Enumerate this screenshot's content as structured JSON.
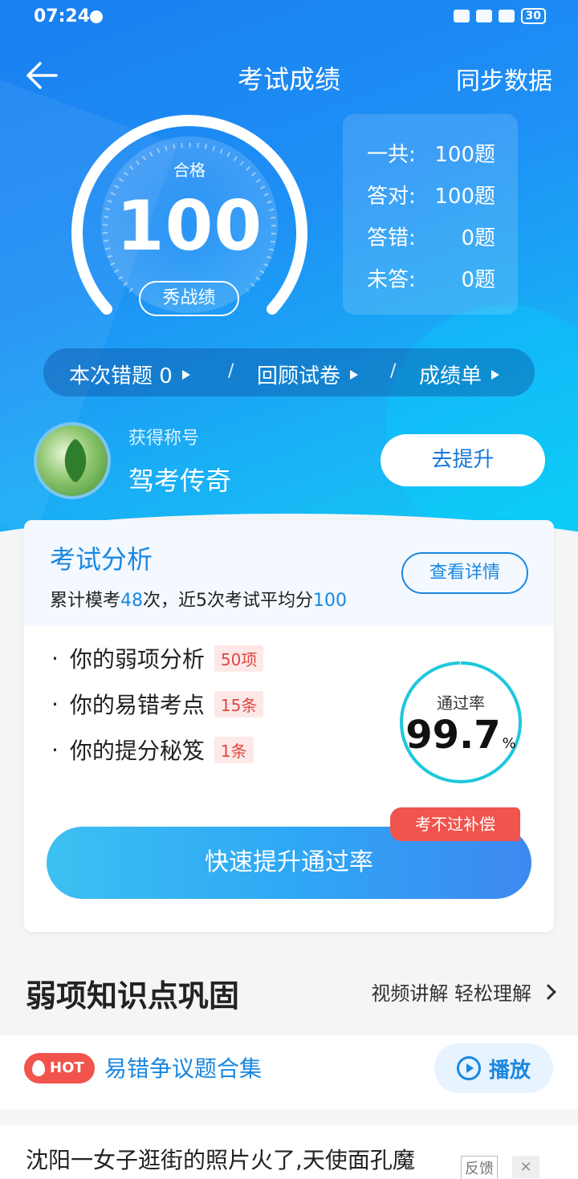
{
  "status": {
    "time": "07:24",
    "battery": "30"
  },
  "nav": {
    "title": "考试成绩",
    "sync": "同步数据"
  },
  "score": {
    "label": "合格",
    "value": "100",
    "show_btn": "秀战绩"
  },
  "stats": [
    {
      "k": "一共:",
      "v": "100题"
    },
    {
      "k": "答对:",
      "v": "100题"
    },
    {
      "k": "答错:",
      "v": "0题"
    },
    {
      "k": "未答:",
      "v": "0题"
    }
  ],
  "pills": {
    "wrong": "本次错题 0",
    "review": "回顾试卷",
    "report": "成绩单",
    "sep": "/"
  },
  "honor": {
    "label": "获得称号",
    "value": "驾考传奇",
    "btn": "去提升"
  },
  "analysis": {
    "title": "考试分析",
    "sub_prefix": "累计模考",
    "count": "48",
    "sub_mid": "次，近5次考试平均分",
    "avg": "100",
    "detail_btn": "查看详情",
    "items": [
      {
        "dot": "·",
        "label": "你的弱项分析",
        "tag": "50项"
      },
      {
        "dot": "·",
        "label": "你的易错考点",
        "tag": "15条"
      },
      {
        "dot": "·",
        "label": "你的提分秘笈",
        "tag": "1条"
      }
    ],
    "rate_label": "通过率",
    "rate_value": "99.7",
    "rate_unit": "%",
    "rate_fraction": 0.997,
    "boost_btn": "快速提升通过率",
    "compensate": "考不过补偿"
  },
  "weak": {
    "title": "弱项知识点巩固",
    "link": "视频讲解 轻松理解"
  },
  "hot": {
    "badge": "HOT",
    "text": "易错争议题合集",
    "play": "播放"
  },
  "news": {
    "text": "沈阳一女子逛街的照片火了,天使面孔魔",
    "feedback": "反馈",
    "close": "×"
  },
  "colors": {
    "primary": "#1a87e0",
    "accent_red": "#f0544c",
    "ring": "#1ec8dc"
  }
}
